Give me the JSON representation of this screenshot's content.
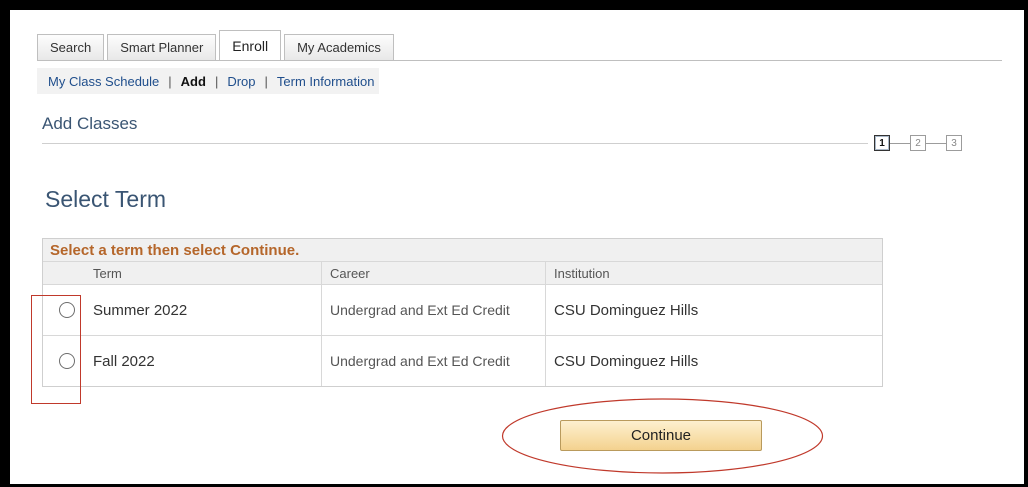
{
  "tabs": [
    {
      "label": "Search",
      "active": false
    },
    {
      "label": "Smart Planner",
      "active": false
    },
    {
      "label": "Enroll",
      "active": true
    },
    {
      "label": "My Academics",
      "active": false
    }
  ],
  "subnav": {
    "my_class_schedule": "My Class Schedule",
    "add": "Add",
    "drop": "Drop",
    "term_information": "Term Information",
    "separator": "|"
  },
  "page_header": "Add Classes",
  "steps": {
    "labels": [
      "1",
      "2",
      "3"
    ],
    "current": 1
  },
  "section_title": "Select Term",
  "grid": {
    "caption": "Select a term then select Continue.",
    "columns": {
      "term": "Term",
      "career": "Career",
      "institution": "Institution"
    },
    "rows": [
      {
        "term": "Summer 2022",
        "career": "Undergrad and Ext Ed Credit",
        "institution": "CSU Dominguez Hills"
      },
      {
        "term": "Fall 2022",
        "career": "Undergrad and Ext Ed Credit",
        "institution": "CSU Dominguez Hills"
      }
    ]
  },
  "continue_label": "Continue",
  "colors": {
    "link": "#1f4e8c",
    "caption": "#b5662a",
    "heading": "#3a5573",
    "annotation": "#c0392b"
  }
}
